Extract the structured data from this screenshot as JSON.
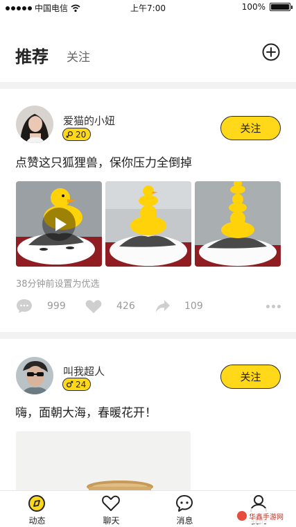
{
  "status_bar": {
    "carrier": "中国电信",
    "time": "上午7:00",
    "battery_text": "100%",
    "battery_level": 1.0
  },
  "header": {
    "tabs": [
      {
        "label": "推荐",
        "active": true
      },
      {
        "label": "关注",
        "active": false
      }
    ],
    "add_icon": "plus-circle-icon"
  },
  "posts": [
    {
      "username": "爱猫的小妞",
      "badge_icon": "female-gender-icon",
      "badge_value": "20",
      "follow_label": "关注",
      "text": "点赞这只狐狸兽，保你压力全倒掉",
      "photos": [
        "cat-with-duck-video",
        "cat-with-two-ducks",
        "cat-with-three-ducks"
      ],
      "meta": "38分钟前设置为优选",
      "comments": "999",
      "likes": "426",
      "shares": "109"
    },
    {
      "username": "叫我超人",
      "badge_icon": "male-gender-icon",
      "badge_value": "24",
      "follow_label": "关注",
      "text": "嗨，面朝大海，春暖花开！"
    }
  ],
  "bottom_nav": [
    {
      "label": "动态",
      "icon": "feed-icon",
      "active": true
    },
    {
      "label": "聊天",
      "icon": "heart-icon",
      "active": false
    },
    {
      "label": "消息",
      "icon": "message-icon",
      "active": false
    },
    {
      "label": "我的",
      "icon": "user-icon",
      "active": false
    }
  ],
  "watermark": "华鑫手游网",
  "colors": {
    "accent": "#ffd81a",
    "text": "#222222",
    "muted": "#999999",
    "divider": "#f2f2f2"
  }
}
